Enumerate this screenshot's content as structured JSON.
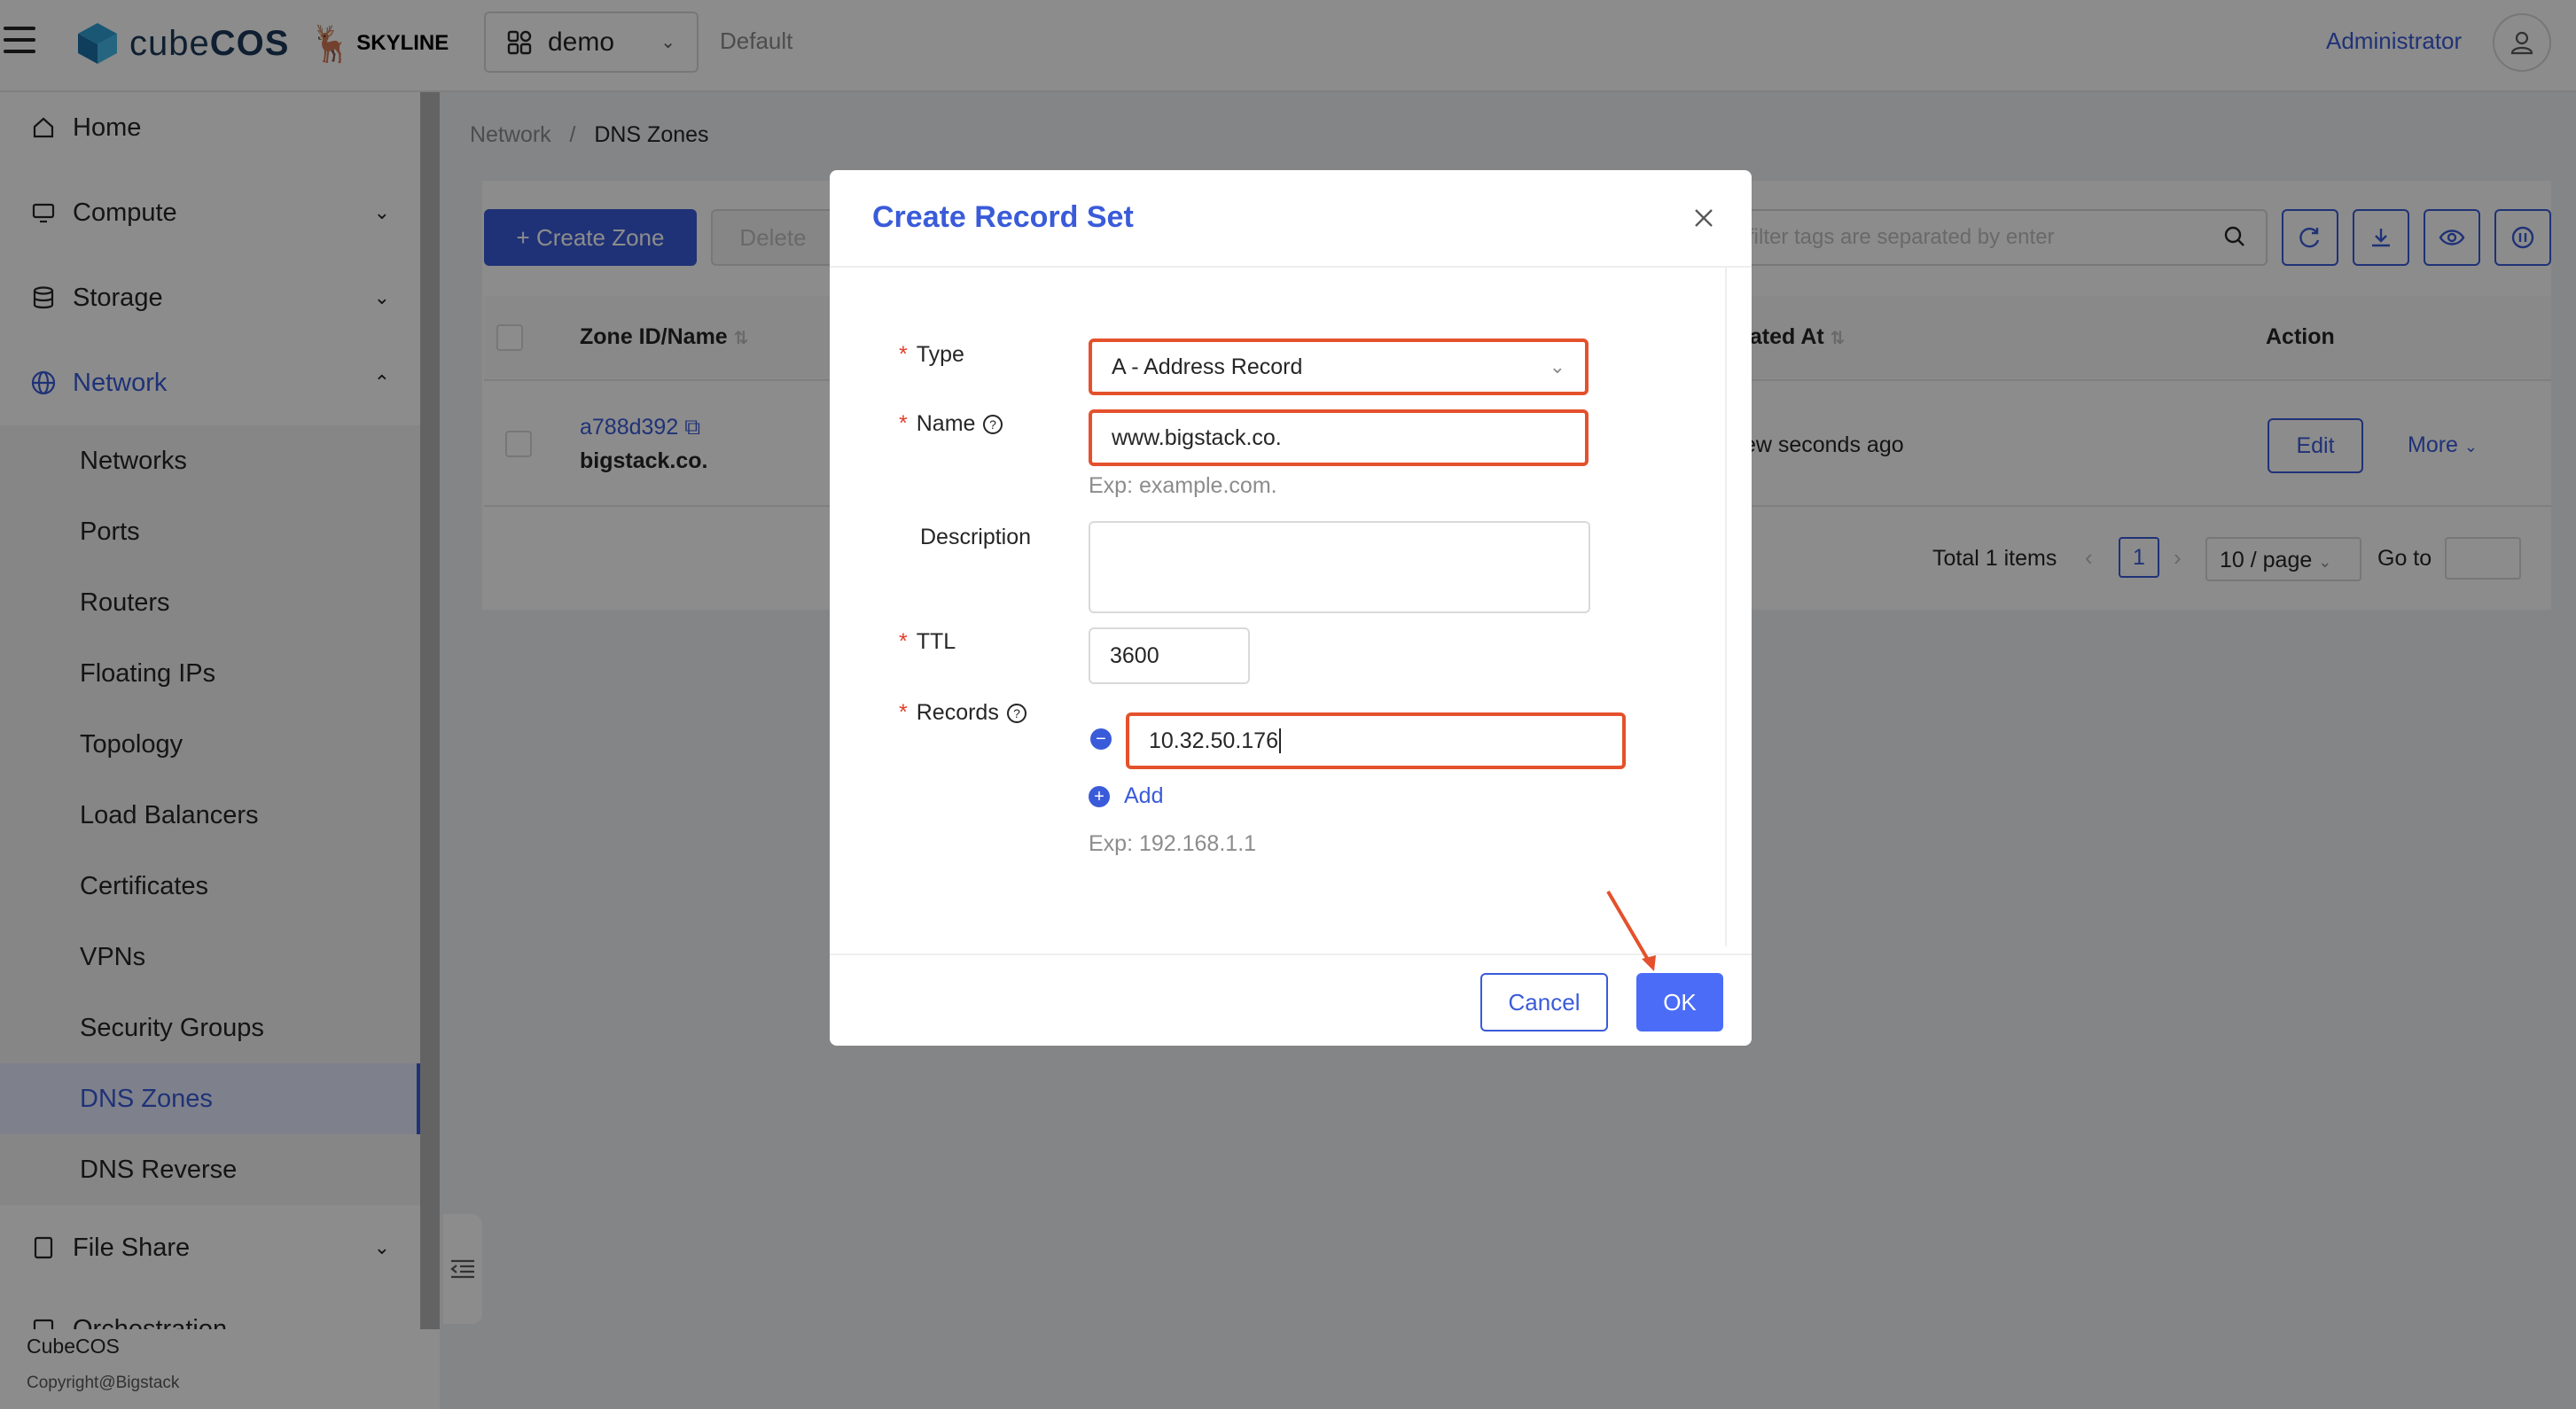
{
  "header": {
    "brand": "cube",
    "brand_bold": "COS",
    "partner": "SKYLINE",
    "project": "demo",
    "domain": "Default",
    "user": "Administrator"
  },
  "sidebar": {
    "items": [
      {
        "label": "Home",
        "icon": "home-icon"
      },
      {
        "label": "Compute",
        "icon": "monitor-icon"
      },
      {
        "label": "Storage",
        "icon": "database-icon"
      },
      {
        "label": "Network",
        "icon": "globe-icon"
      },
      {
        "label": "File Share",
        "icon": "file-icon"
      },
      {
        "label": "Orchestration",
        "icon": "orchestration-icon"
      }
    ],
    "network_sub": [
      "Networks",
      "Ports",
      "Routers",
      "Floating IPs",
      "Topology",
      "Load Balancers",
      "Certificates",
      "VPNs",
      "Security Groups",
      "DNS Zones",
      "DNS Reverse"
    ],
    "footer_name": "CubeCOS",
    "footer_copy": "Copyright@Bigstack"
  },
  "breadcrumb": {
    "parent": "Network",
    "separator": "/",
    "current": "DNS Zones"
  },
  "toolbar": {
    "create_label": "+ Create Zone",
    "delete_label": "Delete",
    "search_placeholder": "filter tags are separated by enter"
  },
  "table": {
    "headers": {
      "name": "Zone ID/Name",
      "created": "eated At",
      "action": "Action"
    },
    "row": {
      "id": "a788d392",
      "name": "bigstack.co.",
      "created": "few seconds ago",
      "edit": "Edit",
      "more": "More"
    }
  },
  "pagination": {
    "total": "Total 1 items",
    "page": "1",
    "page_size": "10 / page",
    "goto": "Go to"
  },
  "modal": {
    "title": "Create Record Set",
    "fields": {
      "type_label": "Type",
      "type_value": "A - Address Record",
      "name_label": "Name",
      "name_value": "www.bigstack.co.",
      "name_hint": "Exp: example.com.",
      "description_label": "Description",
      "description_value": "",
      "ttl_label": "TTL",
      "ttl_value": "3600",
      "records_label": "Records",
      "records_value": "10.32.50.176",
      "add_label": "Add",
      "records_hint": "Exp: 192.168.1.1"
    },
    "cancel": "Cancel",
    "ok": "OK"
  },
  "colors": {
    "accent": "#3a5bd9",
    "highlight": "#e4512c",
    "required": "#e33e2b"
  }
}
